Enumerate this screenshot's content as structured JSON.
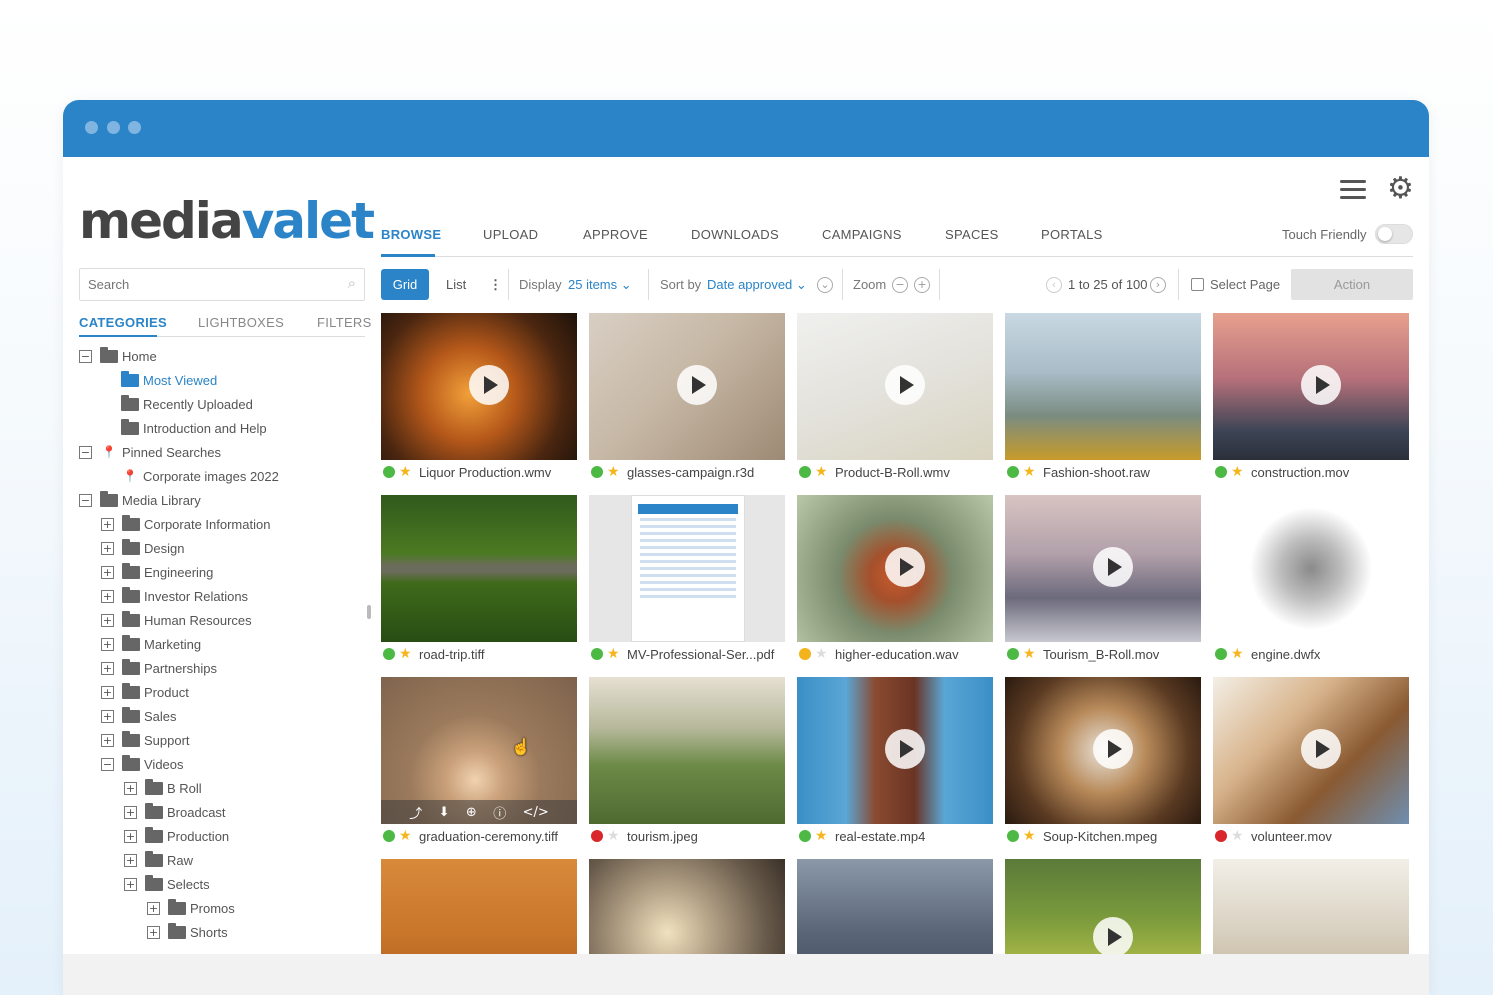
{
  "app": {
    "logo_part1": "media",
    "logo_part2": "valet"
  },
  "nav": {
    "tabs": [
      "BROWSE",
      "UPLOAD",
      "APPROVE",
      "DOWNLOADS",
      "CAMPAIGNS",
      "SPACES",
      "PORTALS"
    ],
    "touch_friendly_label": "Touch Friendly"
  },
  "sidebar": {
    "search_placeholder": "Search",
    "tabs": [
      "CATEGORIES",
      "LIGHTBOXES",
      "FILTERS"
    ],
    "tree": [
      "Home",
      "Most Viewed",
      "Recently Uploaded",
      "Introduction and Help",
      "Pinned Searches",
      "Corporate images 2022",
      "Media Library",
      "Corporate Information",
      "Design",
      "Engineering",
      "Investor Relations",
      "Human Resources",
      "Marketing",
      "Partnerships",
      "Product",
      "Sales",
      "Support",
      "Videos",
      "B Roll",
      "Broadcast",
      "Production",
      "Raw",
      "Selects",
      "Promos",
      "Shorts"
    ]
  },
  "toolbar": {
    "grid": "Grid",
    "list": "List",
    "display_label": "Display",
    "display_value": "25 items ⌄",
    "sort_label": "Sort by",
    "sort_value": "Date approved ⌄",
    "zoom_label": "Zoom",
    "pagination": "1 to 25 of 100",
    "select_page": "Select Page",
    "action": "Action"
  },
  "assets": [
    {
      "name": "Liquor Production.wmv",
      "status": "#4cb944",
      "rating": "5"
    },
    {
      "name": "glasses-campaign.r3d",
      "status": "#4cb944",
      "rating": "5"
    },
    {
      "name": "Product-B-Roll.wmv",
      "status": "#4cb944",
      "rating": "5"
    },
    {
      "name": "Fashion-shoot.raw",
      "status": "#4cb944",
      "rating": "4"
    },
    {
      "name": "construction.mov",
      "status": "#4cb944",
      "rating": "5"
    },
    {
      "name": "road-trip.tiff",
      "status": "#4cb944",
      "rating": "4"
    },
    {
      "name": "MV-Professional-Ser...pdf",
      "status": "#4cb944",
      "rating": "5"
    },
    {
      "name": "higher-education.wav",
      "status": "#f2b31c",
      "rating": ""
    },
    {
      "name": "Tourism_B-Roll.mov",
      "status": "#4cb944",
      "rating": "5"
    },
    {
      "name": "engine.dwfx",
      "status": "#4cb944",
      "rating": "5"
    },
    {
      "name": "graduation-ceremony.tiff",
      "status": "#4cb944",
      "rating": "5"
    },
    {
      "name": "tourism.jpeg",
      "status": "#d9262c",
      "rating": ""
    },
    {
      "name": "real-estate.mp4",
      "status": "#4cb944",
      "rating": "4"
    },
    {
      "name": "Soup-Kitchen.mpeg",
      "status": "#4cb944",
      "rating": "5"
    },
    {
      "name": "volunteer.mov",
      "status": "#d9262c",
      "rating": ""
    }
  ],
  "colors": {
    "accent": "#2a84c7",
    "approved": "#4cb944",
    "pending": "#f2b31c",
    "rejected": "#d9262c",
    "star": "#f5b51c"
  }
}
